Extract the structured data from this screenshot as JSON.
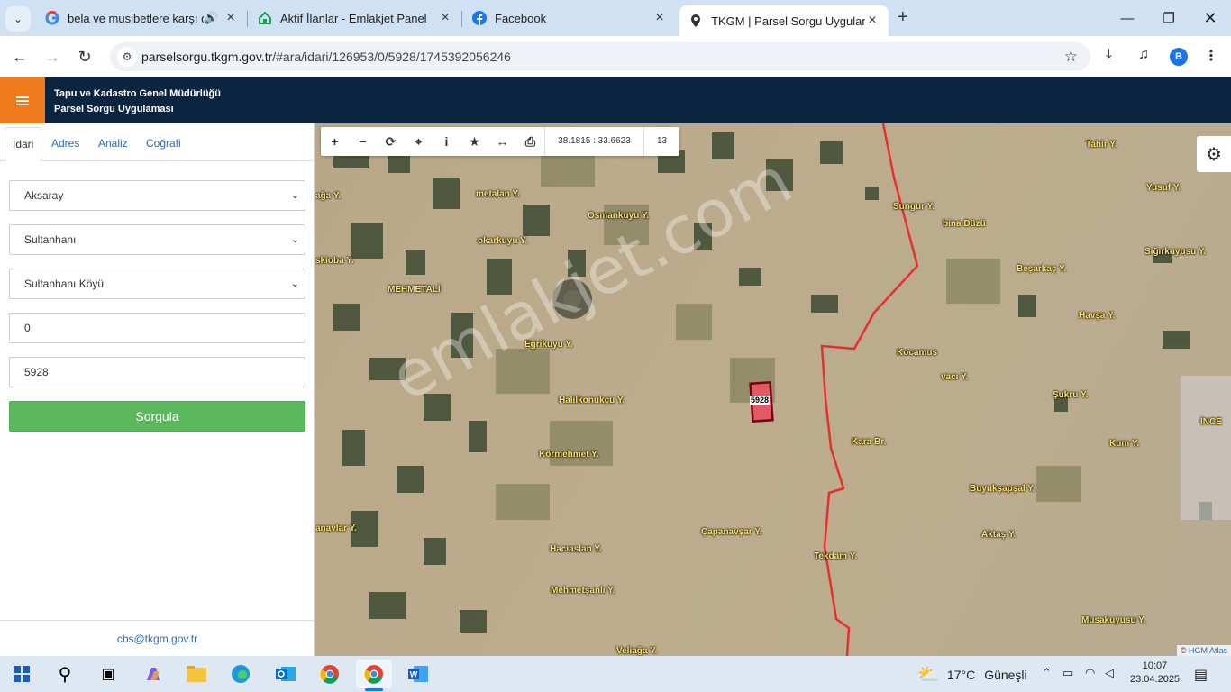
{
  "browser": {
    "tabs": [
      {
        "title": "bela ve musibetlere karşı du",
        "icon": "google-icon"
      },
      {
        "title": "Aktif İlanlar - Emlakjet Panel",
        "icon": "emlakjet-icon"
      },
      {
        "title": "Facebook",
        "icon": "facebook-icon"
      },
      {
        "title": "TKGM | Parsel Sorgu Uygulamas",
        "icon": "location-pin-icon"
      }
    ],
    "url_host": "parselsorgu.tkgm.gov.tr",
    "url_path": "/#ara/idari/126953/0/5928/1745392056246",
    "profile_initial": "B"
  },
  "app": {
    "org_name": "Tapu ve Kadastro Genel Müdürlüğü",
    "app_name": "Parsel Sorgu Uygulaması",
    "tabs": [
      "İdari",
      "Adres",
      "Analiz",
      "Coğrafi"
    ],
    "province": "Aksaray",
    "district": "Sultanhanı",
    "neighborhood": "Sultanhanı Köyü",
    "block": "0",
    "parcel": "5928",
    "submit_label": "Sorgula",
    "contact_email": "cbs@tkgm.gov.tr"
  },
  "map": {
    "coordinates": "38.1815 : 33.6623",
    "zoom": "13",
    "parcel_label": "5928",
    "watermark": "emlakjet.com",
    "attribution_symbol": "©",
    "attribution_link": "HGM Atlas",
    "places": [
      {
        "name": "metalan Y.",
        "l": 178,
        "t": 73
      },
      {
        "name": "Osmankuyu Y.",
        "l": 302,
        "t": 97
      },
      {
        "name": "okarkuyu Y.",
        "l": 180,
        "t": 125
      },
      {
        "name": "skioba Y.",
        "l": 0,
        "t": 147
      },
      {
        "name": "MEHMETALİ",
        "l": 80,
        "t": 179
      },
      {
        "name": "Eğrikuyu Y.",
        "l": 232,
        "t": 240
      },
      {
        "name": "Halilkonukçu Y.",
        "l": 270,
        "t": 302
      },
      {
        "name": "Körmehmet Y.",
        "l": 248,
        "t": 362
      },
      {
        "name": "anavlar Y.",
        "l": 0,
        "t": 444
      },
      {
        "name": "Hacıaslan Y.",
        "l": 260,
        "t": 467
      },
      {
        "name": "Mehmetşanlı Y.",
        "l": 261,
        "t": 513
      },
      {
        "name": "Çapanavşar Y.",
        "l": 428,
        "t": 448
      },
      {
        "name": "Tekdam Y.",
        "l": 553,
        "t": 475
      },
      {
        "name": "Kara Br.",
        "l": 595,
        "t": 348
      },
      {
        "name": "Kocamus",
        "l": 645,
        "t": 249
      },
      {
        "name": "vacı Y.",
        "l": 694,
        "t": 276
      },
      {
        "name": "Sungur Y.",
        "l": 641,
        "t": 87
      },
      {
        "name": "bina Düzü",
        "l": 696,
        "t": 106
      },
      {
        "name": "Tahir Y.",
        "l": 855,
        "t": 18
      },
      {
        "name": "Yusuf Y.",
        "l": 922,
        "t": 66
      },
      {
        "name": "Beşarkaç Y.",
        "l": 778,
        "t": 156
      },
      {
        "name": "Sığırkuyusu Y.",
        "l": 920,
        "t": 137
      },
      {
        "name": "Havşa Y.",
        "l": 847,
        "t": 208
      },
      {
        "name": "Şukru Y.",
        "l": 818,
        "t": 296
      },
      {
        "name": "Kum Y.",
        "l": 881,
        "t": 350
      },
      {
        "name": "İNCE",
        "l": 982,
        "t": 326
      },
      {
        "name": "Buyukşapşal Y.",
        "l": 726,
        "t": 400
      },
      {
        "name": "Aktaş Y.",
        "l": 739,
        "t": 451
      },
      {
        "name": "Musakuyusu Y.",
        "l": 850,
        "t": 546
      },
      {
        "name": "Veliağa Y.",
        "l": 334,
        "t": 580
      },
      {
        "name": "ağa Y.",
        "l": 0,
        "t": 75
      }
    ]
  },
  "taskbar": {
    "temperature": "17°C",
    "weather": "Güneşli",
    "time": "10:07",
    "date": "23.04.2025"
  }
}
